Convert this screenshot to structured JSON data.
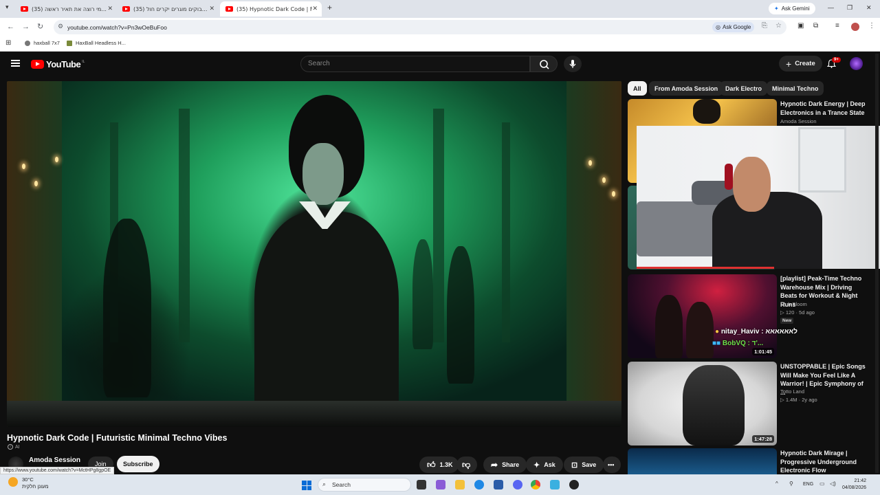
{
  "browser": {
    "tabs": [
      {
        "title": "(35) מי רוצה את תאיר ראשה..."
      },
      {
        "title": "(35) בוקים מוגרים יקרים חול..."
      },
      {
        "title": "(35) Hypnotic Dark Code | F..."
      }
    ],
    "ask_gemini": "Ask Gemini",
    "url": "youtube.com/watch?v=Pn3wOeBuFoo",
    "ask_google": "Ask Google",
    "bookmarks": [
      {
        "label": "haxball 7x7"
      },
      {
        "label": "HaxBall Headless H..."
      }
    ],
    "status_url": "https://www.youtube.com/watch?v=MctHPg8gpOE"
  },
  "youtube": {
    "logo_text": "YouTube",
    "logo_country": "IL",
    "search_placeholder": "Search",
    "create_label": "Create",
    "notification_count": "9+",
    "chips": [
      {
        "label": "All",
        "selected": true
      },
      {
        "label": "From Amoda Session",
        "selected": false
      },
      {
        "label": "Dark Electro",
        "selected": false
      },
      {
        "label": "Minimal Techno",
        "selected": false
      }
    ],
    "video": {
      "title": "Hypnotic Dark Code | Futuristic Minimal Techno Vibes",
      "ai_label": "AI",
      "channel": "Amoda Session",
      "join_label": "Join",
      "subscribe_label": "Subscribe",
      "likes": "1.3K",
      "share_label": "Share",
      "ask_label": "Ask",
      "save_label": "Save"
    },
    "recommendations": [
      {
        "title": "Hypnotic Dark Energy | Deep Electronics in a Trance State",
        "channel": "Amoda Session",
        "meta": "",
        "duration": ""
      },
      {
        "title": "[playlist] Peak-Time Techno Warehouse Mix | Driving Beats for Workout & Night Runs",
        "channel": "Club Bloom",
        "meta": "120 · 5d ago",
        "badge": "New",
        "duration": "1:01:45"
      },
      {
        "title": "UNSTOPPABLE | Epic Songs Will Make You Feel Like A Warrior! | Epic Symphony of ...",
        "channel": "Totto Land",
        "meta": "1.4M · 2y ago",
        "duration": "1:47:28"
      },
      {
        "title": "Hypnotic Dark Mirage | Progressive Underground Electronic Flow",
        "channel": "",
        "meta": "",
        "duration": ""
      }
    ]
  },
  "overlay": {
    "chat_line1": "nitay_Haviv : לאאאאאא",
    "chat_line2": "BobVQ : ד'..."
  },
  "taskbar": {
    "weather_temp": "30°C",
    "weather_desc": "מעונן חלקית",
    "search_label": "Search",
    "lang": "ENG",
    "time": "21:42",
    "date": "04/08/2026"
  },
  "colors": {
    "yt_red": "#ff0000",
    "bg": "#0f0f0f",
    "chat_green": "#6ee04a"
  }
}
